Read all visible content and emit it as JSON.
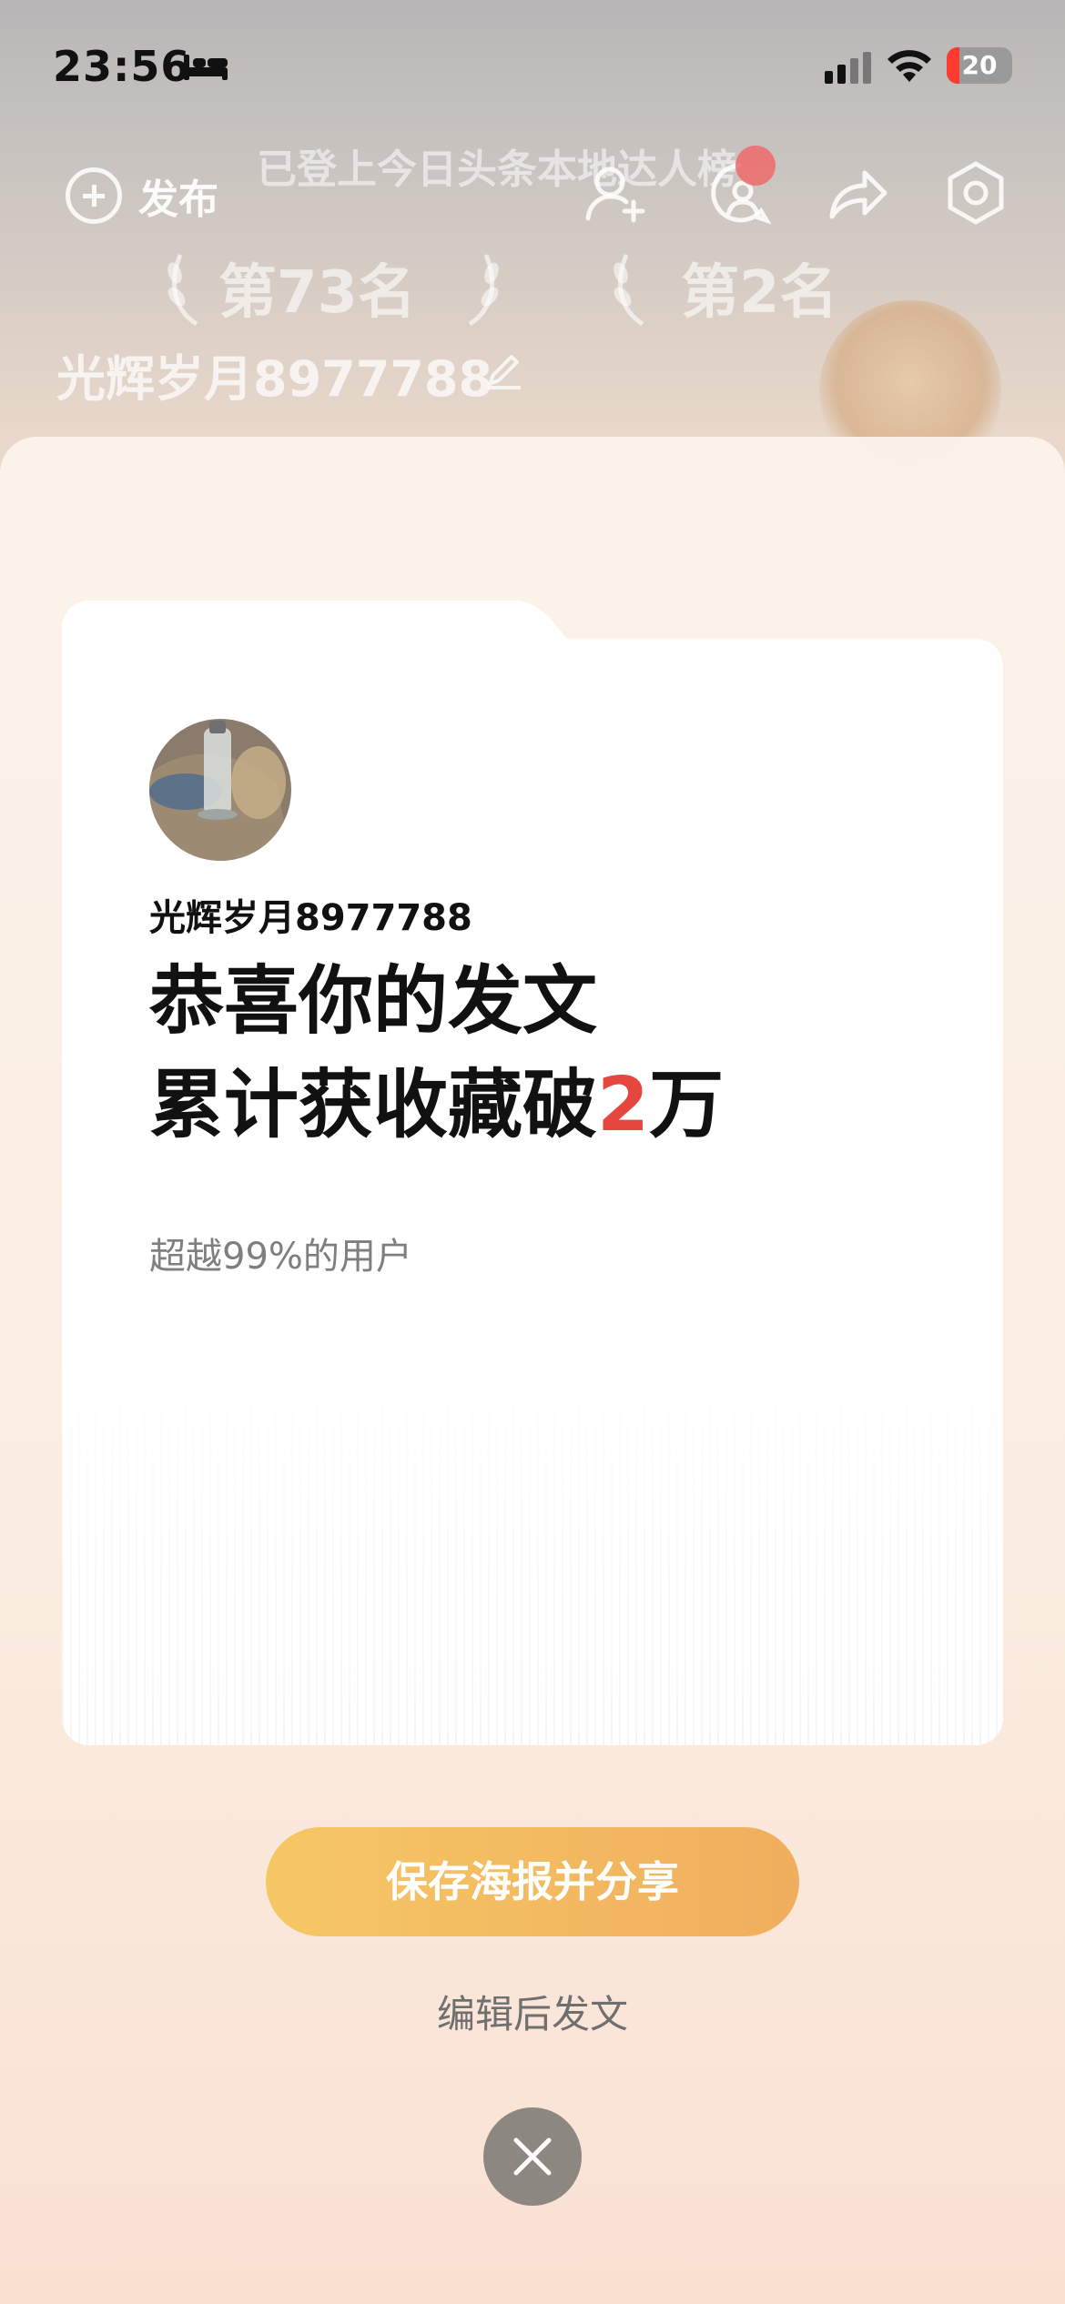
{
  "status_bar": {
    "time": "23:56",
    "battery_level": "20",
    "battery_fraction": 0.2,
    "icons": [
      "bed-icon",
      "signal-icon",
      "wifi-icon",
      "battery-icon"
    ]
  },
  "profile_header": {
    "publish_label": "发布",
    "ranking_banner": "已登上今日头条本地达人榜",
    "rank_left": "第73名",
    "rank_right": "第2名",
    "username": "光辉岁月8977788",
    "icons": [
      "add-friend-icon",
      "messages-icon",
      "share-icon",
      "settings-icon",
      "edit-pencil-icon"
    ]
  },
  "poster": {
    "username": "光辉岁月8977788",
    "headline_line1": "恭喜你的发文",
    "headline_line2_prefix": "累计获收藏破",
    "headline_number": "2",
    "headline_line2_suffix": "万",
    "subline": "超越99%的用户",
    "accent_color": "#e5463d"
  },
  "actions": {
    "save_share_label": "保存海报并分享",
    "edit_post_label": "编辑后发文",
    "button_gradient": [
      "#f6c765",
      "#f0ae5e"
    ]
  }
}
